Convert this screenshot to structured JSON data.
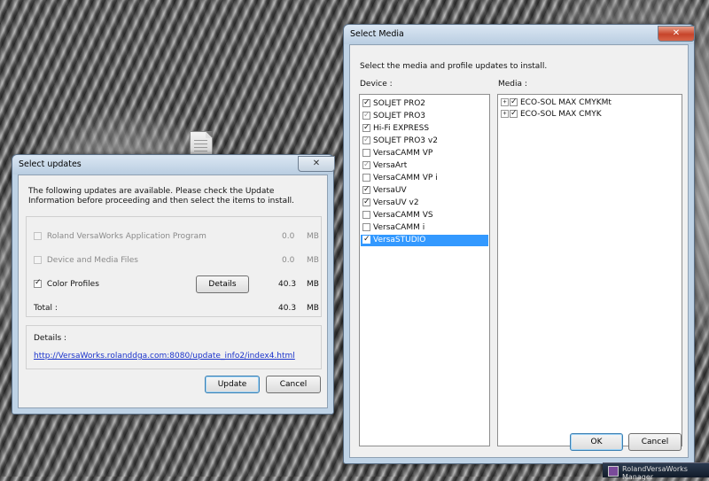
{
  "select_updates": {
    "title": "Select updates",
    "close_glyph": "✕",
    "intro": "The following updates are available. Please check the Update Information before proceeding and then select the items to install.",
    "items": [
      {
        "label": "Roland VersaWorks Application Program",
        "size": "0.0",
        "unit": "MB",
        "checked": false,
        "enabled": false
      },
      {
        "label": "Device and Media Files",
        "size": "0.0",
        "unit": "MB",
        "checked": false,
        "enabled": false
      },
      {
        "label": "Color Profiles",
        "size": "40.3",
        "unit": "MB",
        "checked": true,
        "enabled": true
      }
    ],
    "details_button": "Details",
    "total_label": "Total :",
    "total_size": "40.3",
    "total_unit": "MB",
    "details_label": "Details :",
    "details_link": "http://VersaWorks.rolanddga.com:8080/update_info2/index4.html",
    "update_button": "Update",
    "cancel_button": "Cancel"
  },
  "select_media": {
    "title": "Select Media",
    "close_glyph": "✕",
    "intro": "Select the media and profile updates to install.",
    "device_label": "Device :",
    "media_label": "Media :",
    "devices": [
      {
        "name": "SOLJET PRO2",
        "checked": true,
        "style": "normal"
      },
      {
        "name": "SOLJET PRO3",
        "checked": true,
        "style": "gray"
      },
      {
        "name": "Hi-Fi EXPRESS",
        "checked": true,
        "style": "normal"
      },
      {
        "name": "SOLJET PRO3 v2",
        "checked": true,
        "style": "gray"
      },
      {
        "name": "VersaCAMM VP",
        "checked": false,
        "style": "normal"
      },
      {
        "name": "VersaArt",
        "checked": true,
        "style": "gray"
      },
      {
        "name": "VersaCAMM VP i",
        "checked": false,
        "style": "normal"
      },
      {
        "name": "VersaUV",
        "checked": true,
        "style": "normal"
      },
      {
        "name": "VersaUV v2",
        "checked": true,
        "style": "normal"
      },
      {
        "name": "VersaCAMM VS",
        "checked": false,
        "style": "normal"
      },
      {
        "name": "VersaCAMM i",
        "checked": false,
        "style": "normal"
      },
      {
        "name": "VersaSTUDIO",
        "checked": true,
        "style": "selected"
      }
    ],
    "media": [
      {
        "name": "ECO-SOL MAX CMYKMt",
        "checked": true,
        "expander": "+"
      },
      {
        "name": "ECO-SOL MAX CMYK",
        "checked": true,
        "expander": "+"
      }
    ],
    "ok_button": "OK",
    "cancel_button": "Cancel"
  },
  "taskbar": {
    "label": "RolandVersaWorks Manager"
  }
}
